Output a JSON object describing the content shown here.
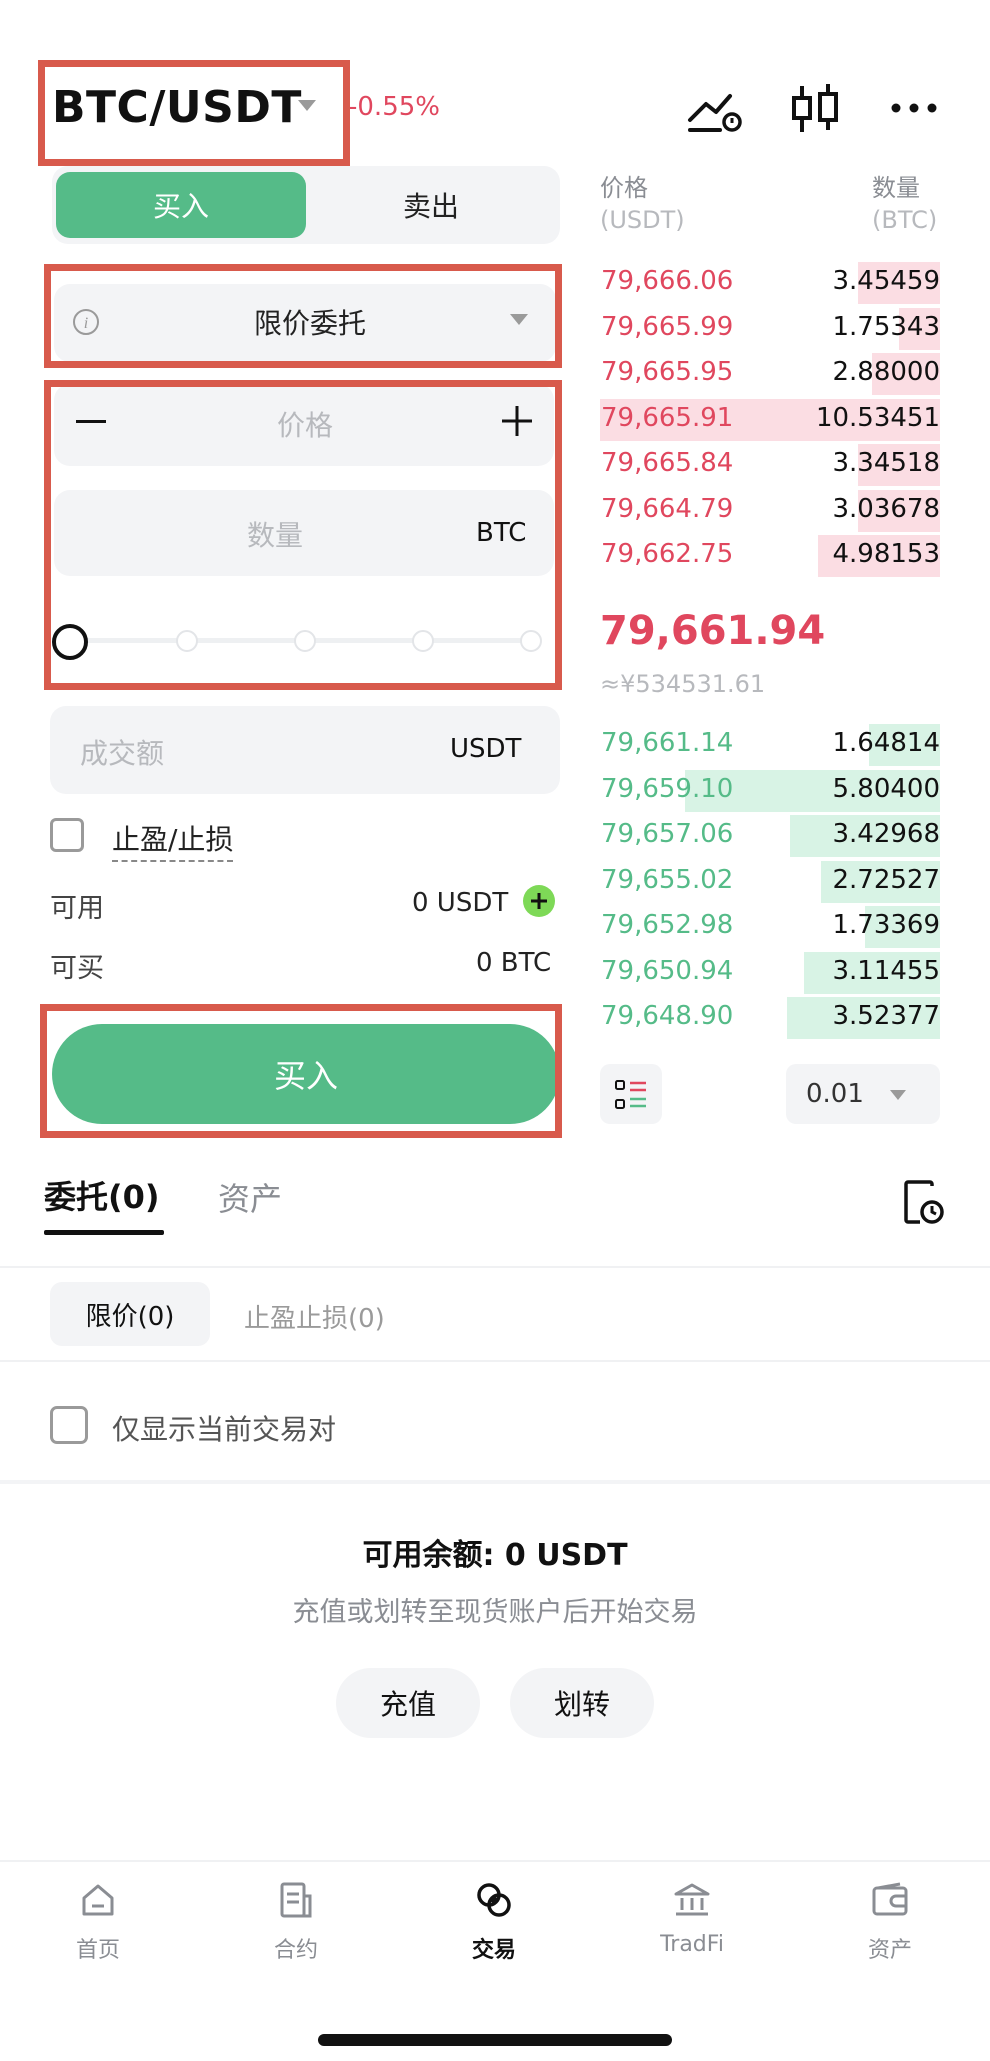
{
  "header": {
    "pair": "BTC/USDT",
    "change": "-0.55%"
  },
  "trade": {
    "buy_tab": "买入",
    "sell_tab": "卖出",
    "order_type": "限价委托",
    "price_placeholder": "价格",
    "amount_placeholder": "数量",
    "amount_unit": "BTC",
    "total_placeholder": "成交额",
    "total_unit": "USDT",
    "tpsl_label": "止盈/止损",
    "available_label": "可用",
    "available_value": "0 USDT",
    "buyable_label": "可买",
    "buyable_value": "0 BTC",
    "submit": "买入",
    "slider_level": 0
  },
  "orderbook": {
    "price_header": "价格",
    "price_unit": "(USDT)",
    "qty_header": "数量",
    "qty_unit": "(BTC)",
    "asks": [
      {
        "price": "79,666.06",
        "qty": "3.45459",
        "depth": 0.24
      },
      {
        "price": "79,665.99",
        "qty": "1.75343",
        "depth": 0.12
      },
      {
        "price": "79,665.95",
        "qty": "2.88000",
        "depth": 0.2
      },
      {
        "price": "79,665.91",
        "qty": "10.53451",
        "depth": 1.0
      },
      {
        "price": "79,665.84",
        "qty": "3.34518",
        "depth": 0.24
      },
      {
        "price": "79,664.79",
        "qty": "3.03678",
        "depth": 0.24
      },
      {
        "price": "79,662.75",
        "qty": "4.98153",
        "depth": 0.36
      }
    ],
    "last_price": "79,661.94",
    "last_price_cny": "≈¥534531.61",
    "bids": [
      {
        "price": "79,661.14",
        "qty": "1.64814",
        "depth": 0.21
      },
      {
        "price": "79,659.10",
        "qty": "5.80400",
        "depth": 0.75
      },
      {
        "price": "79,657.06",
        "qty": "3.42968",
        "depth": 0.44
      },
      {
        "price": "79,655.02",
        "qty": "2.72527",
        "depth": 0.35
      },
      {
        "price": "79,652.98",
        "qty": "1.73369",
        "depth": 0.22
      },
      {
        "price": "79,650.94",
        "qty": "3.11455",
        "depth": 0.4
      },
      {
        "price": "79,648.90",
        "qty": "3.52377",
        "depth": 0.45
      }
    ],
    "precision": "0.01"
  },
  "orders": {
    "tab_orders": "委托(0)",
    "tab_assets": "资产",
    "subtab_limit": "限价(0)",
    "subtab_tpsl": "止盈止损(0)",
    "filter_label": "仅显示当前交易对",
    "balance_title": "可用余额: 0 USDT",
    "balance_hint": "充值或划转至现货账户后开始交易",
    "deposit": "充值",
    "transfer": "划转"
  },
  "nav": {
    "items": [
      {
        "label": "首页",
        "icon": "home-icon"
      },
      {
        "label": "合约",
        "icon": "contract-icon"
      },
      {
        "label": "交易",
        "icon": "trade-icon"
      },
      {
        "label": "TradFi",
        "icon": "bank-icon"
      },
      {
        "label": "资产",
        "icon": "wallet-icon"
      }
    ]
  },
  "colors": {
    "buy": "#55bb88",
    "sell": "#e0475e",
    "annotation_box": "#d85a4c"
  }
}
